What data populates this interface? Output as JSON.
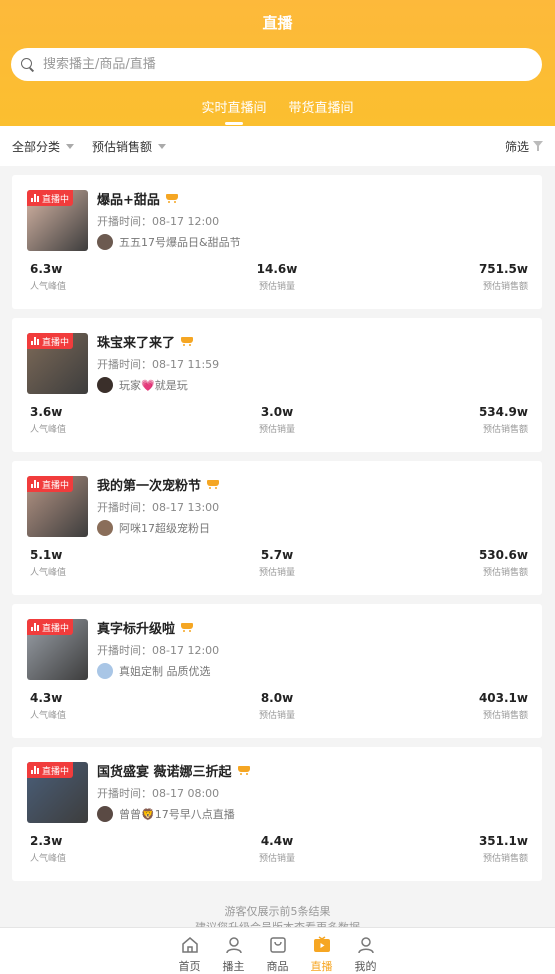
{
  "header": {
    "title": "直播",
    "search_placeholder": "搜索播主/商品/直播",
    "tabs": [
      {
        "label": "实时直播间",
        "active": true
      },
      {
        "label": "带货直播间",
        "active": false
      }
    ]
  },
  "filters": {
    "category": "全部分类",
    "sort": "预估销售额",
    "filter": "筛选"
  },
  "badge_label": "直播中",
  "start_prefix": "开播时间：",
  "stat_labels": {
    "peak": "人气峰值",
    "volume": "预估销量",
    "revenue": "预估销售额"
  },
  "cards": [
    {
      "title": "爆品+甜品",
      "start_time": "08-17 12:00",
      "host": "五五17号爆品日&甜品节",
      "peak": "6.3w",
      "volume": "14.6w",
      "revenue": "751.5w",
      "thumb_color": "#d8b7a6",
      "avatar_color": "#6c5a50"
    },
    {
      "title": "珠宝来了来了",
      "start_time": "08-17 11:59",
      "host": "玩家💗就是玩",
      "peak": "3.6w",
      "volume": "3.0w",
      "revenue": "534.9w",
      "thumb_color": "#7d6a58",
      "avatar_color": "#3a2f2a"
    },
    {
      "title": "我的第一次宠粉节",
      "start_time": "08-17 13:00",
      "host": "阿咪17超级宠粉日",
      "peak": "5.1w",
      "volume": "5.7w",
      "revenue": "530.6w",
      "thumb_color": "#b69585",
      "avatar_color": "#8a6e5a"
    },
    {
      "title": "真字标升级啦",
      "start_time": "08-17 12:00",
      "host": "真姐定制 品质优选",
      "peak": "4.3w",
      "volume": "8.0w",
      "revenue": "403.1w",
      "thumb_color": "#9aa0a8",
      "avatar_color": "#a9c6e6"
    },
    {
      "title": "国货盛宴 薇诺娜三折起",
      "start_time": "08-17 08:00",
      "host": "曾曾🦁17号早八点直播",
      "peak": "2.3w",
      "volume": "4.4w",
      "revenue": "351.1w",
      "thumb_color": "#4a5f7a",
      "avatar_color": "#5a4a44"
    }
  ],
  "footer": {
    "line1": "游客仅展示前5条结果",
    "line2": "建议您升级会员版本查看更多数据"
  },
  "nav": [
    {
      "label": "首页",
      "icon": "home-icon",
      "active": false
    },
    {
      "label": "播主",
      "icon": "person-icon",
      "active": false
    },
    {
      "label": "商品",
      "icon": "bag-icon",
      "active": false
    },
    {
      "label": "直播",
      "icon": "live-tv-icon",
      "active": true
    },
    {
      "label": "我的",
      "icon": "profile-icon",
      "active": false
    }
  ],
  "colors": {
    "accent": "#fbbf2f",
    "badge": "#f13c3c",
    "cart": "#f5a623",
    "nav_active": "#f6a623"
  }
}
